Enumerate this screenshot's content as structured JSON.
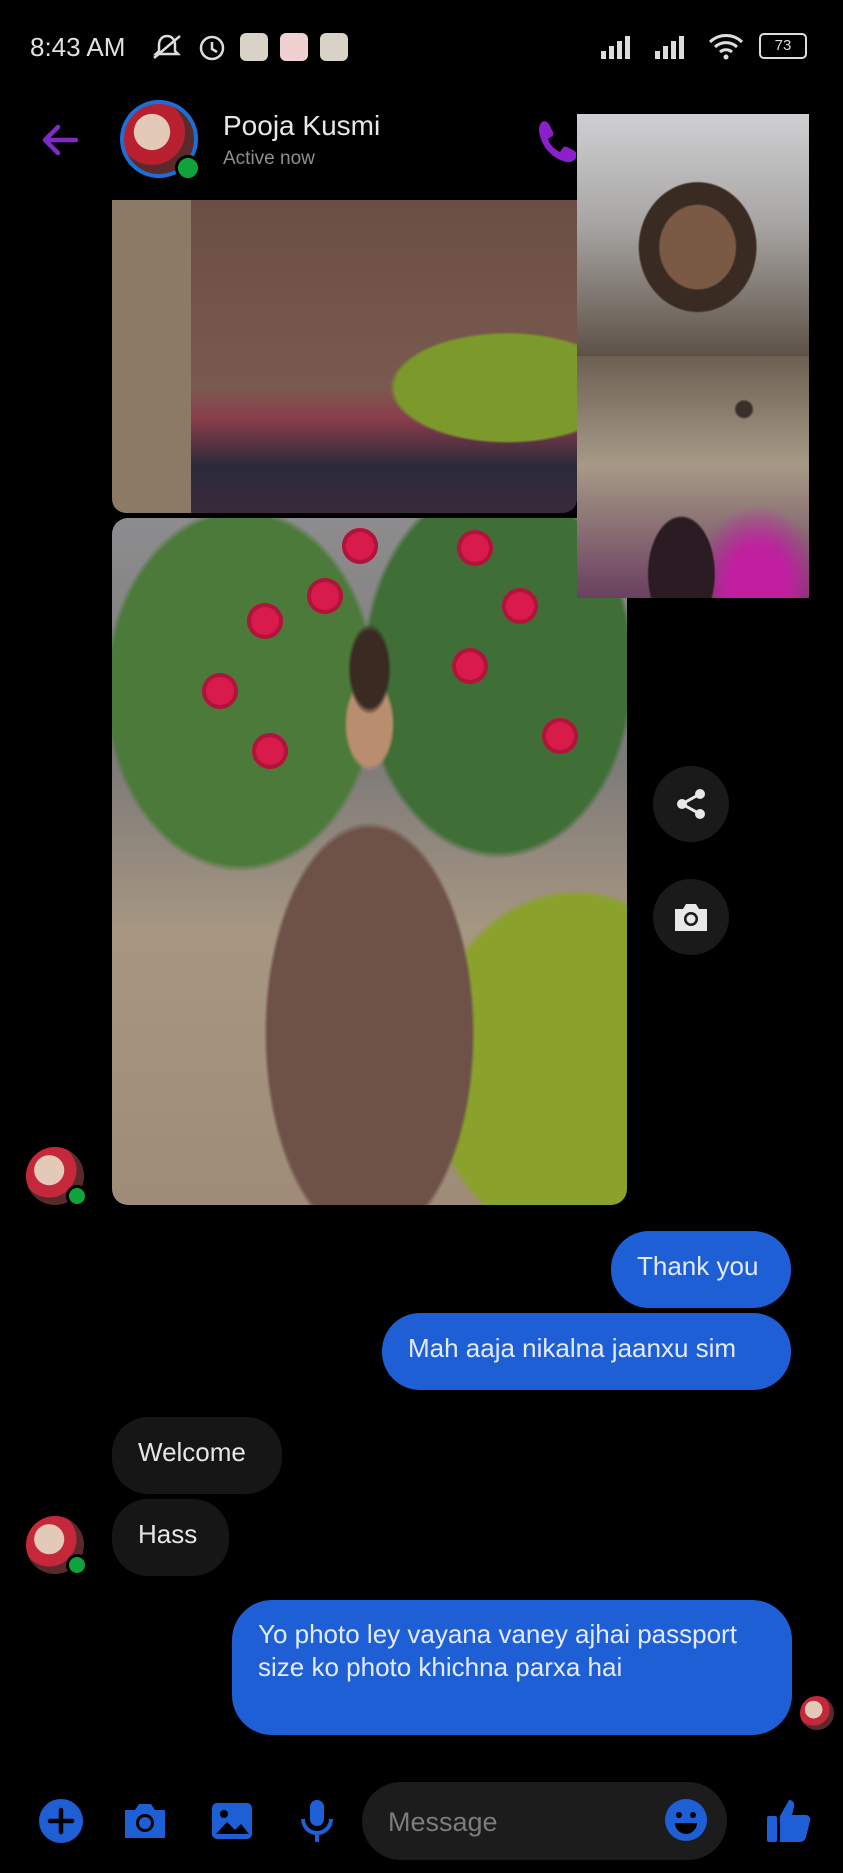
{
  "status_bar": {
    "time": "8:43 AM",
    "battery": "73"
  },
  "header": {
    "contact_name": "Pooja Kusmi",
    "contact_status": "Active now"
  },
  "messages": [
    {
      "text": "Thank you"
    },
    {
      "text": "Mah aaja nikalna jaanxu sim"
    },
    {
      "text": "Welcome"
    },
    {
      "text": "Hass"
    },
    {
      "text": "Yo photo ley vayana vaney ajhai passport size ko photo khichna parxa hai"
    }
  ],
  "composer": {
    "placeholder": "Message"
  },
  "colors": {
    "accent": "#1f5fd6",
    "call_icon": "#8b1fc9",
    "online": "#10a33b"
  }
}
